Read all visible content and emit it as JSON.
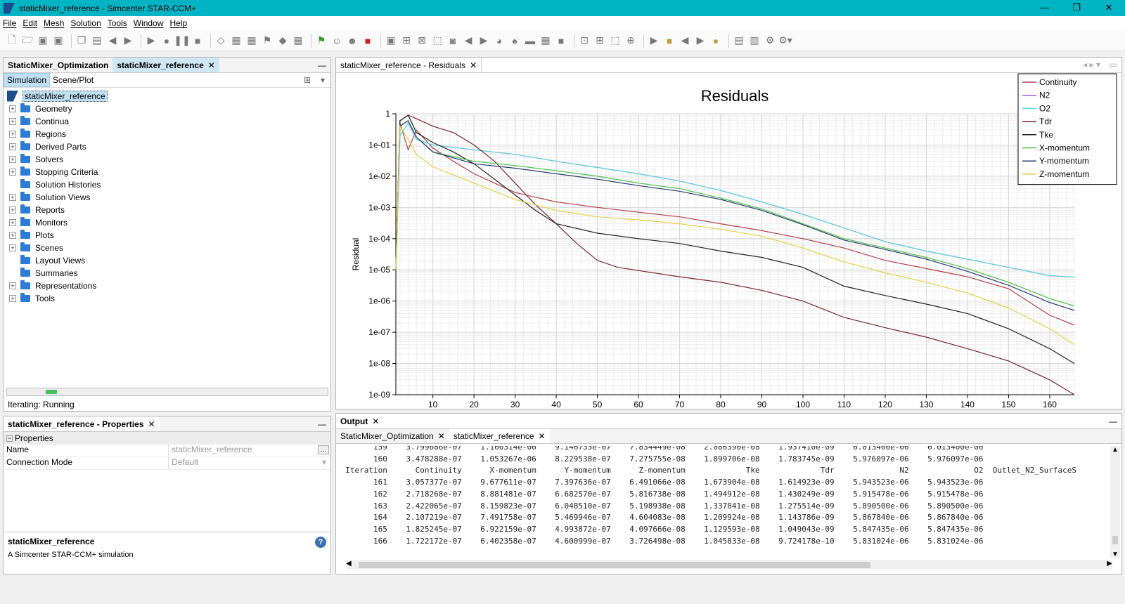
{
  "window": {
    "title": "staticMixer_reference - Simcenter STAR-CCM+",
    "minimize": "—",
    "restore": "❐",
    "close": "✕"
  },
  "menu": [
    "File",
    "Edit",
    "Mesh",
    "Solution",
    "Tools",
    "Window",
    "Help"
  ],
  "tree_panel": {
    "tabs": [
      "StaticMixer_Optimization",
      "staticMixer_reference"
    ],
    "subtabs": [
      "Simulation",
      "Scene/Plot"
    ],
    "root": "staticMixer_reference",
    "items": [
      {
        "label": "Geometry",
        "expandable": true
      },
      {
        "label": "Continua",
        "expandable": true
      },
      {
        "label": "Regions",
        "expandable": true
      },
      {
        "label": "Derived Parts",
        "expandable": true
      },
      {
        "label": "Solvers",
        "expandable": true
      },
      {
        "label": "Stopping Criteria",
        "expandable": true
      },
      {
        "label": "Solution Histories",
        "expandable": false
      },
      {
        "label": "Solution Views",
        "expandable": true
      },
      {
        "label": "Reports",
        "expandable": true
      },
      {
        "label": "Monitors",
        "expandable": true
      },
      {
        "label": "Plots",
        "expandable": true
      },
      {
        "label": "Scenes",
        "expandable": true
      },
      {
        "label": "Layout Views",
        "expandable": false
      },
      {
        "label": "Summaries",
        "expandable": false
      },
      {
        "label": "Representations",
        "expandable": true
      },
      {
        "label": "Tools",
        "expandable": true
      }
    ],
    "status": "Iterating: Running"
  },
  "properties_panel": {
    "tab": "staticMixer_reference - Properties",
    "section": "Properties",
    "rows": [
      {
        "key": "Name",
        "value": "staticMixer_reference"
      },
      {
        "key": "Connection Mode",
        "value": "Default"
      }
    ],
    "desc_title": "staticMixer_reference",
    "desc_text": "A Simcenter STAR-CCM+ simulation"
  },
  "plot_panel": {
    "tab": "staticMixer_reference - Residuals"
  },
  "chart_data": {
    "type": "line",
    "title": "Residuals",
    "xlabel": "Iteration",
    "ylabel": "Residual",
    "y_scale": "log",
    "xlim": [
      1,
      166
    ],
    "ylim": [
      1e-09,
      1
    ],
    "x_ticks": [
      10,
      20,
      30,
      40,
      50,
      60,
      70,
      80,
      90,
      100,
      110,
      120,
      130,
      140,
      150,
      160
    ],
    "y_ticks": [
      {
        "value": 1,
        "label": "1"
      },
      {
        "value": 0.1,
        "label": "1e-01"
      },
      {
        "value": 0.01,
        "label": "1e-02"
      },
      {
        "value": 0.001,
        "label": "1e-03"
      },
      {
        "value": 0.0001,
        "label": "1e-04"
      },
      {
        "value": 1e-05,
        "label": "1e-05"
      },
      {
        "value": 1e-06,
        "label": "1e-06"
      },
      {
        "value": 1e-07,
        "label": "1e-07"
      },
      {
        "value": 1e-08,
        "label": "1e-08"
      },
      {
        "value": 1e-09,
        "label": "1e-09"
      }
    ],
    "grid": true,
    "legend": "top-right",
    "series": [
      {
        "name": "Continuity",
        "color": "#b2404a",
        "x": [
          1,
          2,
          4,
          6,
          10,
          15,
          20,
          25,
          30,
          40,
          50,
          60,
          70,
          80,
          90,
          100,
          110,
          120,
          130,
          140,
          150,
          160,
          166
        ],
        "y": [
          1e-05,
          0.5,
          0.07,
          0.3,
          0.08,
          0.03,
          0.012,
          0.006,
          0.003,
          0.0015,
          0.001,
          0.0007,
          0.0005,
          0.0003,
          0.00018,
          0.0001,
          5e-05,
          2e-05,
          1.1e-05,
          6e-06,
          2.5e-06,
          3.5e-07,
          1.7e-07
        ]
      },
      {
        "name": "N2",
        "color": "#b05ad0",
        "x": [
          1,
          2,
          4,
          6,
          10,
          20,
          30,
          40,
          50,
          60,
          70,
          80,
          90,
          100,
          110,
          120,
          130,
          140,
          150,
          160,
          166
        ],
        "y": [
          1e-05,
          0.2,
          0.5,
          0.15,
          0.1,
          0.07,
          0.05,
          0.03,
          0.019,
          0.012,
          0.007,
          0.0035,
          0.0015,
          0.0006,
          0.00022,
          8e-05,
          4e-05,
          2.2e-05,
          1.2e-05,
          6.5e-06,
          5.8e-06
        ]
      },
      {
        "name": "O2",
        "color": "#5cd8dc",
        "x": [
          1,
          2,
          4,
          6,
          10,
          20,
          30,
          40,
          50,
          60,
          70,
          80,
          90,
          100,
          110,
          120,
          130,
          140,
          150,
          160,
          166
        ],
        "y": [
          1e-05,
          0.2,
          0.5,
          0.15,
          0.1,
          0.07,
          0.05,
          0.03,
          0.019,
          0.012,
          0.007,
          0.0035,
          0.0015,
          0.0006,
          0.00022,
          8e-05,
          4e-05,
          2.2e-05,
          1.2e-05,
          6.5e-06,
          5.8e-06
        ]
      },
      {
        "name": "Tdr",
        "color": "#7a2630",
        "x": [
          1,
          2,
          4,
          6,
          10,
          15,
          20,
          25,
          30,
          35,
          40,
          45,
          50,
          55,
          60,
          70,
          80,
          90,
          100,
          110,
          120,
          130,
          140,
          150,
          160,
          166
        ],
        "y": [
          1e-05,
          0.6,
          0.9,
          0.7,
          0.4,
          0.25,
          0.1,
          0.03,
          0.006,
          0.0012,
          0.0003,
          7e-05,
          2e-05,
          1.2e-05,
          9.5e-06,
          6e-06,
          4e-06,
          2.2e-06,
          1e-06,
          3e-07,
          1.4e-07,
          7e-08,
          3e-08,
          1.2e-08,
          3e-09,
          1e-09
        ]
      },
      {
        "name": "Tke",
        "color": "#222222",
        "x": [
          1,
          2,
          4,
          6,
          10,
          15,
          20,
          25,
          30,
          35,
          40,
          50,
          60,
          70,
          80,
          90,
          100,
          110,
          120,
          130,
          140,
          150,
          160,
          166
        ],
        "y": [
          1e-05,
          0.6,
          0.9,
          0.25,
          0.12,
          0.06,
          0.025,
          0.008,
          0.0025,
          0.0008,
          0.0003,
          0.00015,
          0.0001,
          7e-05,
          4e-05,
          2.5e-05,
          1.2e-05,
          3e-06,
          1.5e-06,
          8e-07,
          4e-07,
          1.3e-07,
          3e-08,
          1e-08
        ]
      },
      {
        "name": "X-momentum",
        "color": "#4cc04c",
        "x": [
          1,
          2,
          4,
          6,
          10,
          20,
          30,
          40,
          50,
          60,
          70,
          80,
          90,
          100,
          110,
          120,
          130,
          140,
          150,
          160,
          166
        ],
        "y": [
          1e-05,
          0.4,
          0.6,
          0.18,
          0.06,
          0.03,
          0.022,
          0.015,
          0.01,
          0.006,
          0.004,
          0.002,
          0.0009,
          0.0003,
          0.0001,
          5e-05,
          2.5e-05,
          1.1e-05,
          4e-06,
          1.2e-06,
          7e-07
        ]
      },
      {
        "name": "Y-momentum",
        "color": "#2a3a70",
        "x": [
          1,
          2,
          4,
          6,
          10,
          20,
          30,
          40,
          50,
          60,
          70,
          80,
          90,
          100,
          110,
          120,
          130,
          140,
          150,
          160,
          166
        ],
        "y": [
          1e-05,
          0.4,
          0.6,
          0.18,
          0.06,
          0.025,
          0.018,
          0.012,
          0.008,
          0.005,
          0.0033,
          0.0018,
          0.0008,
          0.00028,
          9e-05,
          4.5e-05,
          2.2e-05,
          9e-06,
          3.2e-06,
          9e-07,
          5e-07
        ]
      },
      {
        "name": "Z-momentum",
        "color": "#e6d04a",
        "x": [
          1,
          2,
          4,
          6,
          10,
          20,
          30,
          40,
          50,
          60,
          70,
          80,
          90,
          100,
          110,
          120,
          130,
          140,
          150,
          160,
          166
        ],
        "y": [
          1e-05,
          0.4,
          0.15,
          0.05,
          0.02,
          0.006,
          0.0018,
          0.0008,
          0.0005,
          0.0004,
          0.0003,
          0.0002,
          0.00012,
          5e-05,
          1.8e-05,
          8e-06,
          4e-06,
          1.8e-06,
          6e-07,
          1.3e-07,
          4e-08
        ]
      }
    ]
  },
  "output_panel": {
    "title": "Output",
    "tabs": [
      "StaticMixer_Optimization",
      "staticMixer_reference"
    ],
    "lines": [
      "        159    3.799686e-07    1.160314e-06    9.146735e-07    7.834449e-08    2.086390e-08    1.937410e-09    6.013400e-06    6.013400e-06",
      "        160    3.478288e-07    1.053267e-06    8.229538e-07    7.275755e-08    1.899706e-08    1.783745e-09    5.976097e-06    5.976097e-06",
      "  Iteration      Continuity      X-momentum      Y-momentum      Z-momentum             Tke             Tdr              N2              O2  Outlet_N2_SurfaceS",
      "        161    3.057377e-07    9.677611e-07    7.397636e-07    6.491066e-08    1.673904e-08    1.614923e-09    5.943523e-06    5.943523e-06",
      "        162    2.718268e-07    8.881481e-07    6.682570e-07    5.816738e-08    1.494912e-08    1.430249e-09    5.915478e-06    5.915478e-06",
      "        163    2.422065e-07    8.159823e-07    6.048510e-07    5.198938e-08    1.337841e-08    1.275514e-09    5.890500e-06    5.890500e-06",
      "        164    2.107219e-07    7.491758e-07    5.469946e-07    4.604083e-08    1.209924e-08    1.143786e-09    5.867840e-06    5.867840e-06",
      "        165    1.825245e-07    6.922159e-07    4.993872e-07    4.097666e-08    1.129593e-08    1.049043e-09    5.847435e-06    5.847435e-06",
      "        166    1.722172e-07    6.402358e-07    4.600999e-07    3.726498e-08    1.045833e-08    9.724178e-10    5.831024e-06    5.831024e-06"
    ]
  }
}
